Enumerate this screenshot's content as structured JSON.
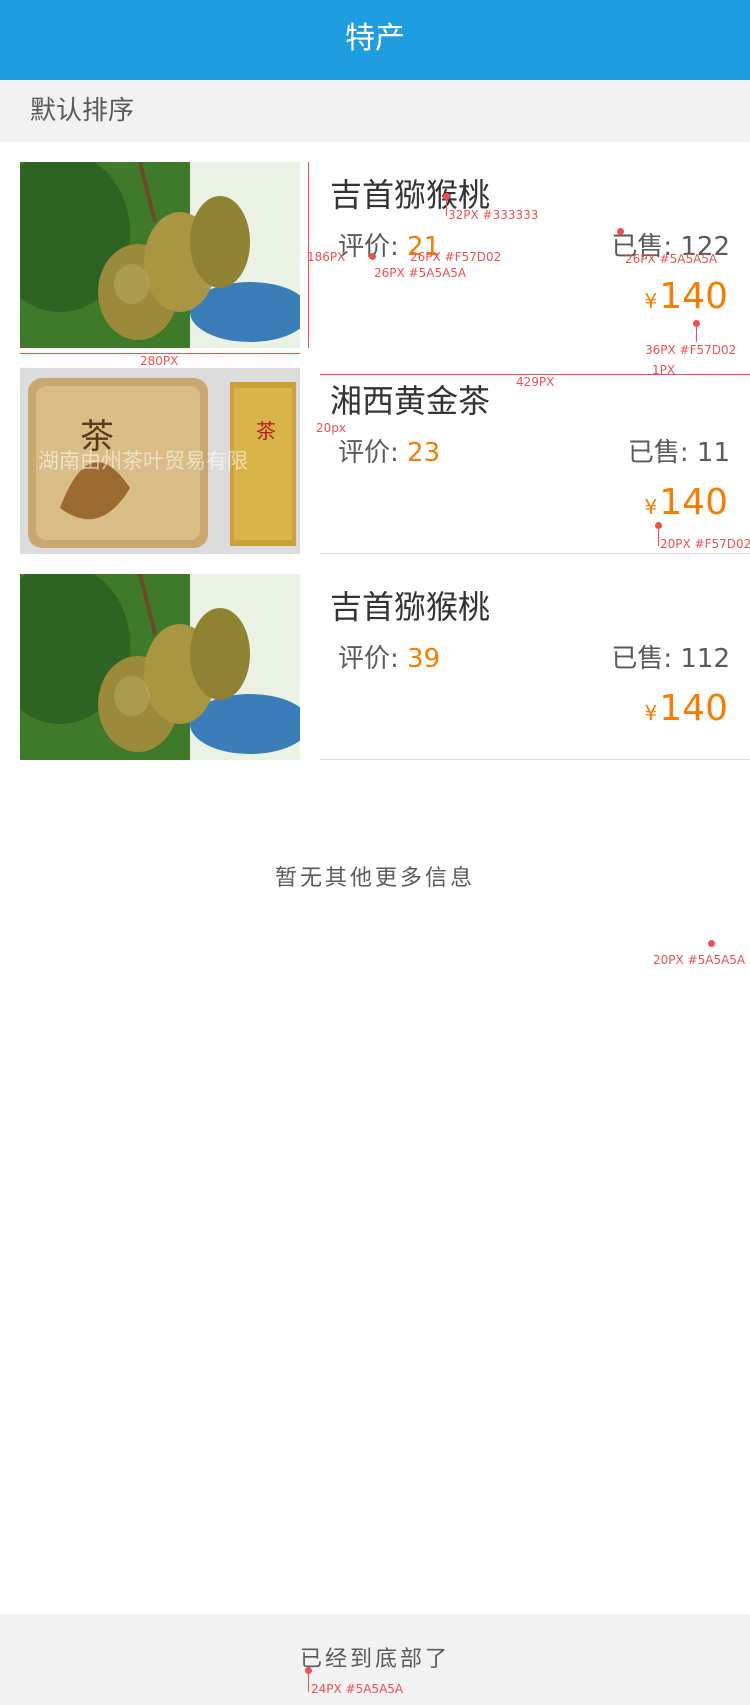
{
  "header": {
    "title": "特产"
  },
  "sort": {
    "label": "默认排序"
  },
  "products": [
    {
      "name": "吉首猕猴桃",
      "rating_label": "评价:",
      "rating_value": "21",
      "sold_label": "已售:",
      "sold_value": "122",
      "currency": "¥",
      "price": "140",
      "image": "kiwi-fruit-photo"
    },
    {
      "name": "湘西黄金茶",
      "rating_label": "评价:",
      "rating_value": "23",
      "sold_label": "已售:",
      "sold_value": "11",
      "currency": "¥",
      "price": "140",
      "image": "golden-tea-package-photo",
      "image_watermark": "湖南由州茶叶贸易有限"
    },
    {
      "name": "吉首猕猴桃",
      "rating_label": "评价:",
      "rating_value": "39",
      "sold_label": "已售:",
      "sold_value": "112",
      "currency": "¥",
      "price": "140",
      "image": "kiwi-fruit-photo"
    }
  ],
  "no_more_text": "暂无其他更多信息",
  "footer": {
    "text": "已经到底部了"
  },
  "annotations": {
    "name_spec": "32PX #333333",
    "rating_label_spec": "26PX #5A5A5A",
    "rating_value_spec": "26PX #F57D02",
    "sold_spec": "26PX #5A5A5A",
    "price_spec": "36PX #F57D02",
    "currency_spec": "20PX #F57D02",
    "image_width": "280PX",
    "image_height": "186PX",
    "text_block_width": "429PX",
    "divider_height": "1PX",
    "item_gap": "20px",
    "no_more_spec": "20PX #5A5A5A",
    "footer_spec": "24PX #5A5A5A"
  },
  "colors": {
    "header_bg": "#1E9DE0",
    "accent": "#F57D02",
    "text_primary": "#333333",
    "text_secondary": "#5A5A5A",
    "annotation": "#F05050"
  }
}
